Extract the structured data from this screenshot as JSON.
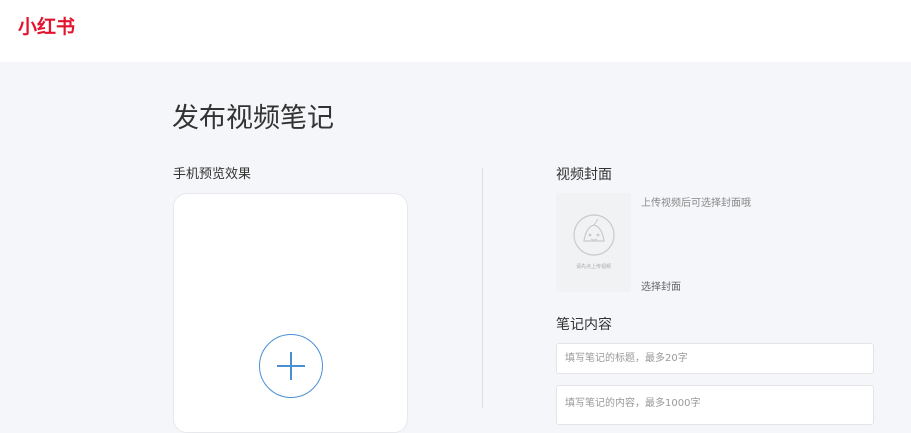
{
  "header": {
    "logo_text": "小红书",
    "brand_color": "#e4132d"
  },
  "main": {
    "page_title": "发布视频笔记",
    "preview": {
      "label": "手机预览效果",
      "add_icon": "plus-icon",
      "accent_color": "#4a8fd6"
    },
    "cover": {
      "label": "视频封面",
      "thumbnail_caption": "请先点上传视频",
      "hint": "上传视频后可选择封面哦",
      "select_label": "选择封面"
    },
    "content": {
      "label": "笔记内容",
      "title_placeholder": "填写笔记的标题，最多20字",
      "body_placeholder": "填写笔记的内容，最多1000字"
    }
  }
}
